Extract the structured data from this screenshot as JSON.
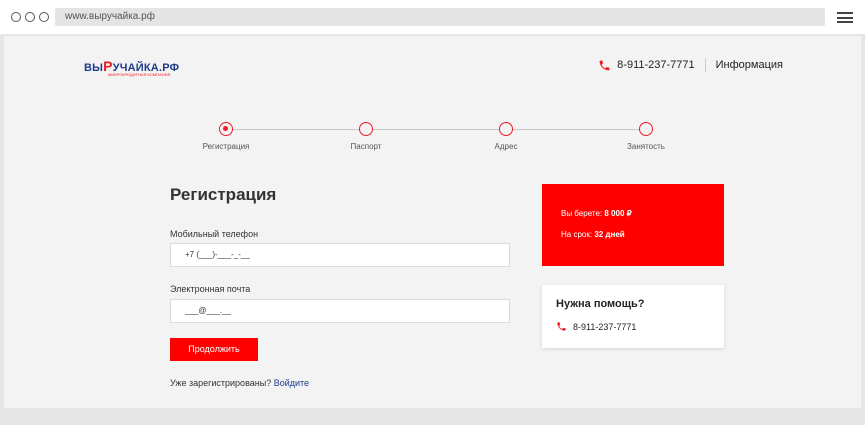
{
  "browser": {
    "url": "www.выручайка.рф"
  },
  "header": {
    "logo_text_a": "ВЫ",
    "logo_text_r": "Р",
    "logo_text_b": "УЧАЙКА.РФ",
    "logo_subtitle": "МИКРОКРЕДИТНАЯ КОМПАНИЯ",
    "phone": "8-911-237-7771",
    "info_link": "Информация"
  },
  "steps": [
    {
      "label": "Регистрация",
      "active": true
    },
    {
      "label": "Паспорт",
      "active": false
    },
    {
      "label": "Адрес",
      "active": false
    },
    {
      "label": "Занятость",
      "active": false
    }
  ],
  "form": {
    "title": "Регистрация",
    "phone_label": "Мобильный телефон",
    "phone_value": "+7 (___)-___-_-__",
    "email_label": "Электронная почта",
    "email_value": "___@___.__",
    "submit_label": "Продолжить",
    "login_prompt": "Уже зарегистрированы?",
    "login_link": "Войдите"
  },
  "loan": {
    "amount_label": "Вы берете:",
    "amount_value": "8 000 ₽",
    "term_label": "На срок:",
    "term_value": "32 дней"
  },
  "help": {
    "title": "Нужна помощь?",
    "phone": "8-911-237-7771"
  },
  "colors": {
    "accent": "#ff0000",
    "brand_blue": "#1e3a8a"
  }
}
